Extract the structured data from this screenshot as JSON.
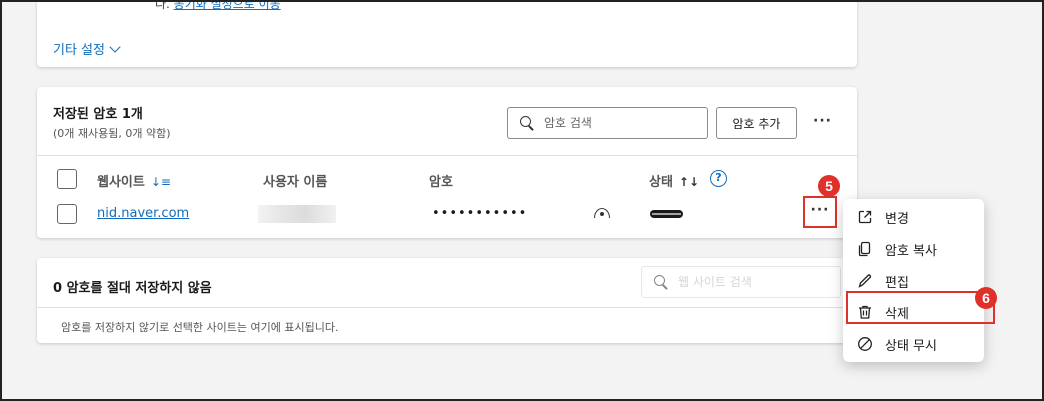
{
  "top_card": {
    "note_prefix": "다. ",
    "note_link": "동기화 설정으로 이동",
    "other_settings": "기타 설정"
  },
  "saved": {
    "title": "저장된 암호 1개",
    "subtitle": "(0개 재사용됨, 0개 약함)",
    "search_placeholder": "암호 검색",
    "add_button": "암호 추가",
    "more": "···",
    "columns": {
      "website": "웹사이트",
      "username": "사용자 이름",
      "password": "암호",
      "status": "상태"
    },
    "rows": [
      {
        "site": "nid.naver.com",
        "password": "•••••••••••",
        "row_more": "···"
      }
    ],
    "help_glyph": "?"
  },
  "never_saved": {
    "title": "0 암호를 절대 저장하지 않음",
    "search_placeholder": "웹 사이트 검색",
    "note": "암호를 저장하지 않기로 선택한 사이트는 여기에 표시됩니다."
  },
  "context_menu": {
    "items": [
      {
        "label": "변경",
        "icon": "open-external-icon"
      },
      {
        "label": "암호 복사",
        "icon": "copy-icon"
      },
      {
        "label": "편집",
        "icon": "pencil-icon"
      },
      {
        "label": "삭제",
        "icon": "trash-icon"
      },
      {
        "label": "상태 무시",
        "icon": "prohibited-icon"
      }
    ]
  },
  "badges": {
    "step5": "5",
    "step6": "6"
  },
  "colors": {
    "accent": "#0f6cbd",
    "annotation": "#e0302a"
  }
}
